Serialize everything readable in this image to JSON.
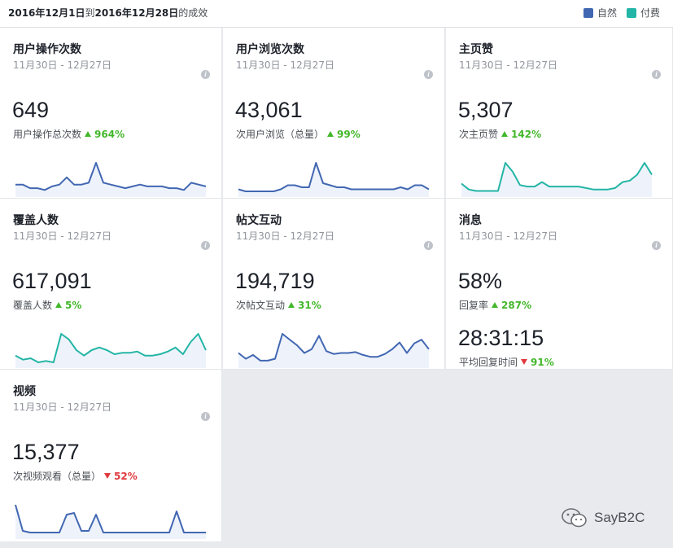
{
  "header": {
    "date_from": "2016年12月1日",
    "connector": "到",
    "date_to": "2016年12月28日",
    "suffix": "的成效",
    "legend": [
      {
        "label": "自然",
        "color": "#4267b2"
      },
      {
        "label": "付费",
        "color": "#23b5a5"
      }
    ]
  },
  "cards": [
    {
      "name": "用户操作次数",
      "range": "11月30日 - 12月27日",
      "value": "649",
      "sub_label": "用户操作总次数",
      "change": "964%",
      "direction": "up",
      "color": "#4267b2",
      "series": [
        6,
        6,
        4,
        4,
        3,
        5,
        6,
        10,
        6,
        6,
        7,
        18,
        7,
        6,
        5,
        4,
        5,
        6,
        5,
        5,
        5,
        4,
        4,
        3,
        7,
        6,
        5
      ]
    },
    {
      "name": "用户浏览次数",
      "range": "11月30日 - 12月27日",
      "value": "43,061",
      "sub_label": "次用户浏览（总量）",
      "change": "99%",
      "direction": "up",
      "color": "#4267b2",
      "series": [
        3,
        2,
        2,
        2,
        2,
        2,
        3,
        5,
        5,
        4,
        4,
        16,
        6,
        5,
        4,
        4,
        3,
        3,
        3,
        3,
        3,
        3,
        3,
        4,
        3,
        5,
        5,
        3
      ]
    },
    {
      "name": "主页赞",
      "range": "11月30日 - 12月27日",
      "value": "5,307",
      "sub_label": "次主页赞",
      "change": "142%",
      "direction": "up",
      "color": "#23b5a5",
      "series": [
        8,
        4,
        3,
        3,
        3,
        3,
        22,
        16,
        7,
        6,
        6,
        9,
        6,
        6,
        6,
        6,
        6,
        5,
        4,
        4,
        4,
        5,
        9,
        10,
        14,
        22,
        14
      ]
    },
    {
      "name": "覆盖人数",
      "range": "11月30日 - 12月27日",
      "value": "617,091",
      "sub_label": "覆盖人数",
      "change": "5%",
      "direction": "up",
      "color": "#23b5a5",
      "series": [
        8,
        5,
        6,
        3,
        4,
        3,
        24,
        20,
        12,
        8,
        12,
        14,
        12,
        9,
        10,
        10,
        11,
        8,
        8,
        9,
        11,
        14,
        9,
        18,
        24,
        12
      ]
    },
    {
      "name": "帖文互动",
      "range": "11月30日 - 12月27日",
      "value": "194,719",
      "sub_label": "次帖文互动",
      "change": "31%",
      "direction": "up",
      "color": "#4267b2",
      "series": [
        14,
        8,
        12,
        6,
        6,
        8,
        34,
        28,
        22,
        14,
        18,
        32,
        16,
        13,
        14,
        14,
        15,
        12,
        10,
        10,
        13,
        18,
        25,
        14,
        24,
        28,
        18
      ]
    },
    {
      "name": "消息",
      "range": "11月30日 - 12月27日",
      "value": "58%",
      "sub_label": "回复率",
      "change": "287%",
      "direction": "up",
      "value2": "28:31:15",
      "sub_label2": "平均回复时间",
      "change2": "91%",
      "direction2": "down"
    },
    {
      "name": "视频",
      "range": "11月30日 - 12月27日",
      "value": "15,377",
      "sub_label": "次视频观看（总量）",
      "change": "52%",
      "direction": "down",
      "color": "#4267b2",
      "series": [
        20,
        4,
        3,
        3,
        3,
        3,
        3,
        14,
        15,
        4,
        4,
        14,
        3,
        3,
        3,
        3,
        3,
        3,
        3,
        3,
        3,
        3,
        16,
        3,
        3,
        3,
        3
      ]
    }
  ],
  "watermark": {
    "text": "SayB2C"
  }
}
